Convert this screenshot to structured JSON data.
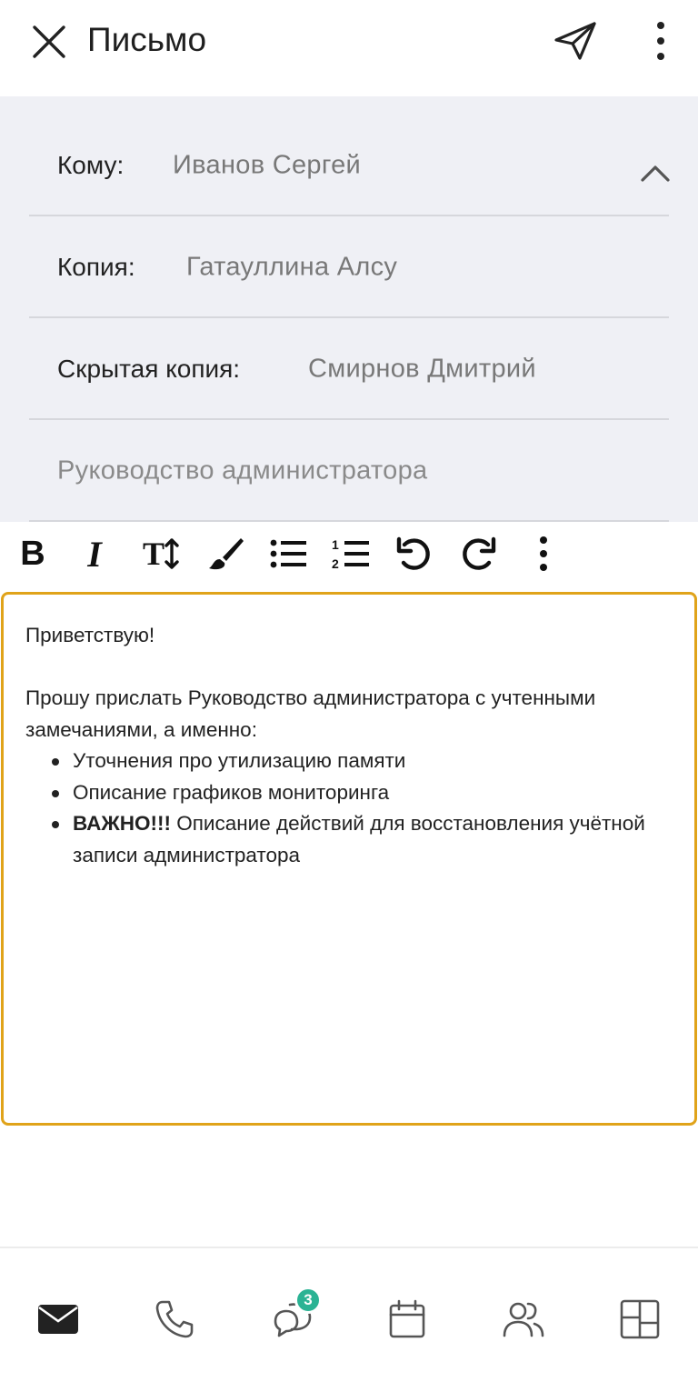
{
  "header": {
    "title": "Письмо",
    "close_icon": "close-icon",
    "send_icon": "send-icon",
    "more_icon": "more-vertical-icon"
  },
  "recipients": {
    "to": {
      "label": "Кому:",
      "value": "Иванов Сергей"
    },
    "cc": {
      "label": "Копия:",
      "value": "Гатауллина Алсу"
    },
    "bcc": {
      "label": "Скрытая копия:",
      "value": "Смирнов Дмитрий"
    },
    "subject": "Руководство администратора"
  },
  "toolbar": {
    "bold_label": "B",
    "italic_label": "I",
    "font_size_label": "T",
    "icons": [
      "bold-icon",
      "italic-icon",
      "text-size-icon",
      "brush-icon",
      "bullet-list-icon",
      "numbered-list-icon",
      "undo-icon",
      "redo-icon",
      "more-vertical-icon"
    ]
  },
  "body": {
    "greeting": "Приветствую!",
    "intro": "Прошу прислать Руководство администратора с учтенными замечаниями, а именно:",
    "items": [
      {
        "bold": "",
        "text": "Уточнения про утилизацию памяти"
      },
      {
        "bold": "",
        "text": "Описание графиков мониторинга"
      },
      {
        "bold": "ВАЖНО!!!",
        "text": " Описание действий для восстановления учётной записи администратора"
      }
    ]
  },
  "bottom_nav": {
    "items": [
      "mail-icon",
      "phone-icon",
      "chat-icon",
      "calendar-icon",
      "contacts-icon",
      "apps-icon"
    ],
    "chat_badge": "3"
  },
  "colors": {
    "accent": "#e0a31a",
    "recipients_bg": "#eff0f5",
    "badge": "#2bb394"
  }
}
